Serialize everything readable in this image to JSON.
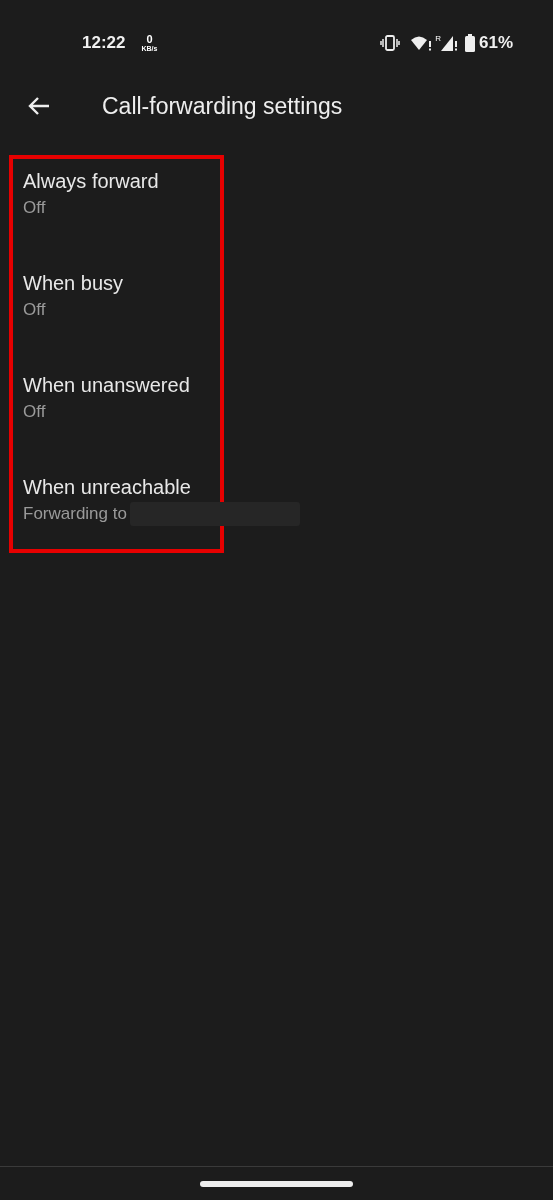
{
  "status_bar": {
    "time": "12:22",
    "net_speed_value": "0",
    "net_speed_unit": "KB/s",
    "roaming_mark": "R",
    "battery": "61%"
  },
  "toolbar": {
    "title": "Call-forwarding settings"
  },
  "highlighted": true,
  "items": [
    {
      "title": "Always forward",
      "summary": "Off"
    },
    {
      "title": "When busy",
      "summary": "Off"
    },
    {
      "title": "When unanswered",
      "summary": "Off"
    },
    {
      "title": "When unreachable",
      "summary": "Forwarding to",
      "summary_tail": {
        "kind": "redacted"
      }
    }
  ]
}
